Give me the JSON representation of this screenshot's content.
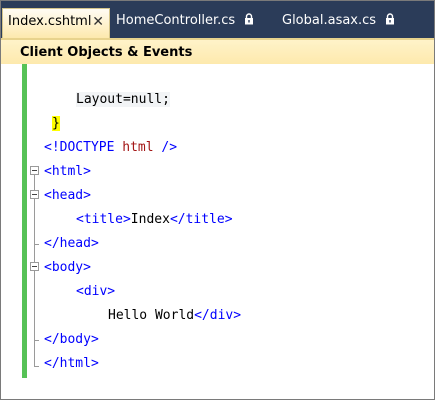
{
  "tabs": [
    {
      "label": "Index.cshtml",
      "active": true,
      "close": "✕",
      "locked": false
    },
    {
      "label": "HomeController.cs",
      "active": false,
      "locked": true
    },
    {
      "label": "Global.asax.cs",
      "active": false,
      "locked": true
    }
  ],
  "navbar": {
    "combo_label": "Client Objects & Events"
  },
  "code": {
    "razor_open": "@{",
    "razor_stmt": "Layout=null;",
    "razor_close": "}",
    "doctype_open": "<!",
    "doctype_word": "DOCTYPE",
    "doctype_attr": "html",
    "doctype_close": "/>",
    "html_open": "<html>",
    "head_open": "<head>",
    "title_open": "<title>",
    "title_text": "Index",
    "title_close": "</title>",
    "head_close": "</head>",
    "body_open": "<body>",
    "div_open": "<div>",
    "div_text": "Hello World",
    "div_close": "</div>",
    "body_close": "</body>",
    "html_close": "</html>"
  },
  "colors": {
    "tabstrip": "#2b3c59",
    "active_tab": "#fde9ad",
    "change_bar": "#56c256",
    "html_tag": "#0000ff",
    "html_attr": "#a31515",
    "razor_marker": "#ffff00"
  }
}
